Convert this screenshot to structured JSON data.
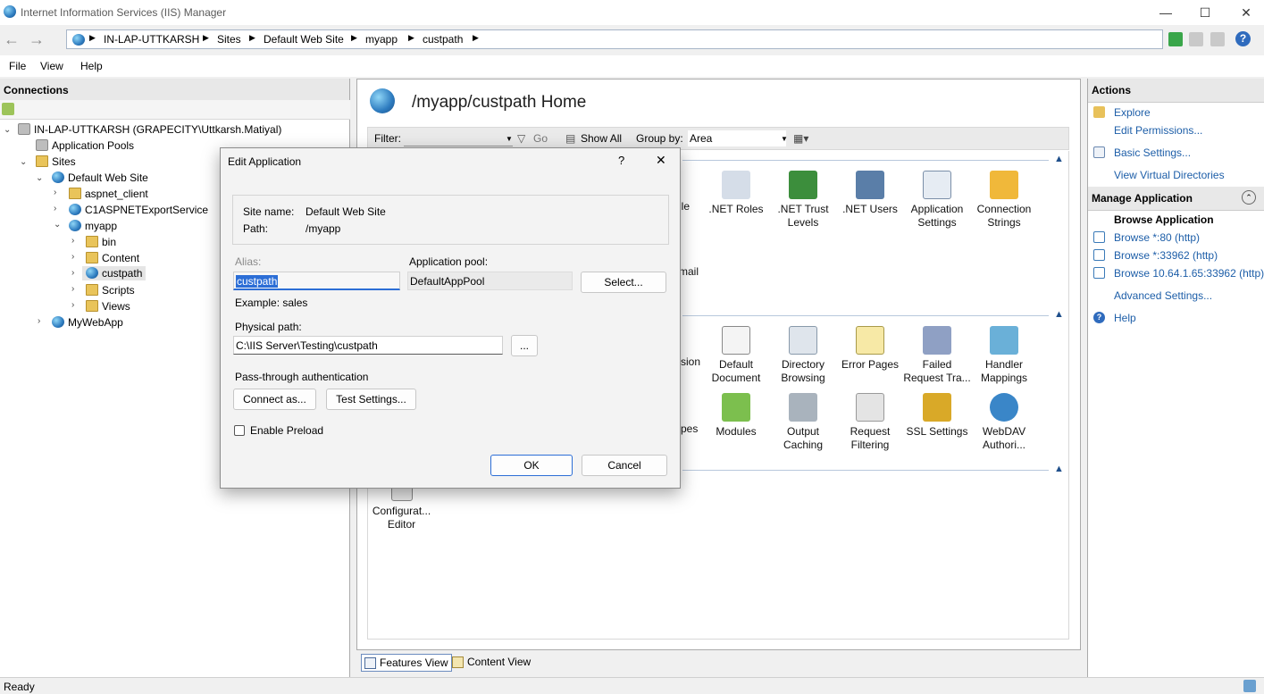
{
  "window": {
    "title": "Internet Information Services (IIS) Manager",
    "minimize": "—",
    "maximize": "☐",
    "close": "✕"
  },
  "address": {
    "crumbs": [
      "IN-LAP-UTTKARSH",
      "Sites",
      "Default Web Site",
      "myapp",
      "custpath"
    ]
  },
  "menu": {
    "items": [
      "File",
      "View",
      "Help"
    ]
  },
  "connections": {
    "title": "Connections",
    "tree": [
      {
        "label": "IN-LAP-UTTKARSH (GRAPECITY\\Uttkarsh.Matiyal)"
      },
      {
        "label": "Application Pools"
      },
      {
        "label": "Sites"
      },
      {
        "label": "Default Web Site"
      },
      {
        "label": "aspnet_client"
      },
      {
        "label": "C1ASPNETExportService"
      },
      {
        "label": "myapp"
      },
      {
        "label": "bin"
      },
      {
        "label": "Content"
      },
      {
        "label": "custpath"
      },
      {
        "label": "Scripts"
      },
      {
        "label": "Views"
      },
      {
        "label": "MyWebApp"
      }
    ]
  },
  "center": {
    "title": "/myapp/custpath Home",
    "filter_label": "Filter:",
    "go_label": "Go",
    "show_all_label": "Show All",
    "group_by_label": "Group by:",
    "group_by_value": "Area",
    "features": [
      {
        "label": "ofile"
      },
      {
        "label": ".NET Roles"
      },
      {
        "label": ".NET Trust Levels"
      },
      {
        "label": ".NET Users"
      },
      {
        "label": "Application Settings"
      },
      {
        "label": "Connection Strings"
      },
      {
        "label": "mail"
      },
      {
        "label": "sion"
      },
      {
        "label": "Default Document"
      },
      {
        "label": "Directory Browsing"
      },
      {
        "label": "Error Pages"
      },
      {
        "label": "Failed Request Tra..."
      },
      {
        "label": "Handler Mappings"
      },
      {
        "label": "pes"
      },
      {
        "label": "Modules"
      },
      {
        "label": "Output Caching"
      },
      {
        "label": "Request Filtering"
      },
      {
        "label": "SSL Settings"
      },
      {
        "label": "WebDAV Authori..."
      },
      {
        "label": "Configurat... Editor"
      }
    ],
    "tabs": [
      "Features View",
      "Content View"
    ]
  },
  "actions": {
    "title": "Actions",
    "explore": "Explore",
    "edit_permissions": "Edit Permissions...",
    "basic_settings": "Basic Settings...",
    "view_virtual_dirs": "View Virtual Directories",
    "manage_title": "Manage Application",
    "browse_title": "Browse Application",
    "browse": [
      "Browse *:80 (http)",
      "Browse *:33962 (http)",
      "Browse 10.64.1.65:33962 (http)"
    ],
    "advanced": "Advanced Settings...",
    "help": "Help"
  },
  "status": {
    "text": "Ready"
  },
  "dialog": {
    "title": "Edit Application",
    "help": "?",
    "close": "✕",
    "site_name_label": "Site name:",
    "site_name_value": "Default Web Site",
    "path_label": "Path:",
    "path_value": "/myapp",
    "alias_label": "Alias:",
    "alias_value": "custpath",
    "pool_label": "Application pool:",
    "pool_value": "DefaultAppPool",
    "select_button": "Select...",
    "example": "Example: sales",
    "physical_label": "Physical path:",
    "physical_value": "C:\\IIS Server\\Testing\\custpath",
    "browse_button": "...",
    "passthrough_label": "Pass-through authentication",
    "connect_button": "Connect as...",
    "test_button": "Test Settings...",
    "preload_label": "Enable Preload",
    "preload_checked": false,
    "ok": "OK",
    "cancel": "Cancel"
  }
}
